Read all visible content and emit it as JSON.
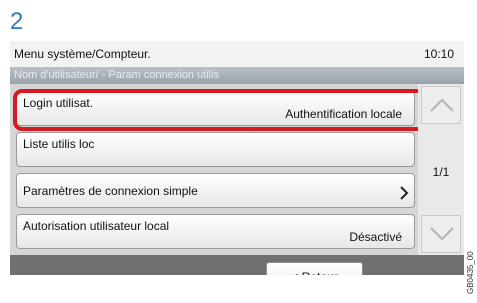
{
  "step_number": "2",
  "title_bar": {
    "title": "Menu système/Compteur.",
    "time": "10:10"
  },
  "breadcrumb": "Nom d'utilisateur/   - Param connexion utilis",
  "list": [
    {
      "label": "Login utilisat.",
      "value": "Authentification locale"
    },
    {
      "label": "Liste utilis loc",
      "value": ""
    },
    {
      "label": "Paramètres de connexion simple",
      "value": "",
      "icon": "chevron-right-icon"
    },
    {
      "label": "Autorisation utilisateur local",
      "value": "Désactivé"
    }
  ],
  "pager": {
    "page": "1/1",
    "up_icon": "arrow-up-icon",
    "down_icon": "arrow-down-icon"
  },
  "back_button": "< Retour",
  "image_code": "GB0435_00",
  "colors": {
    "highlight": "#d61a1f",
    "step": "#2f7cc4"
  }
}
